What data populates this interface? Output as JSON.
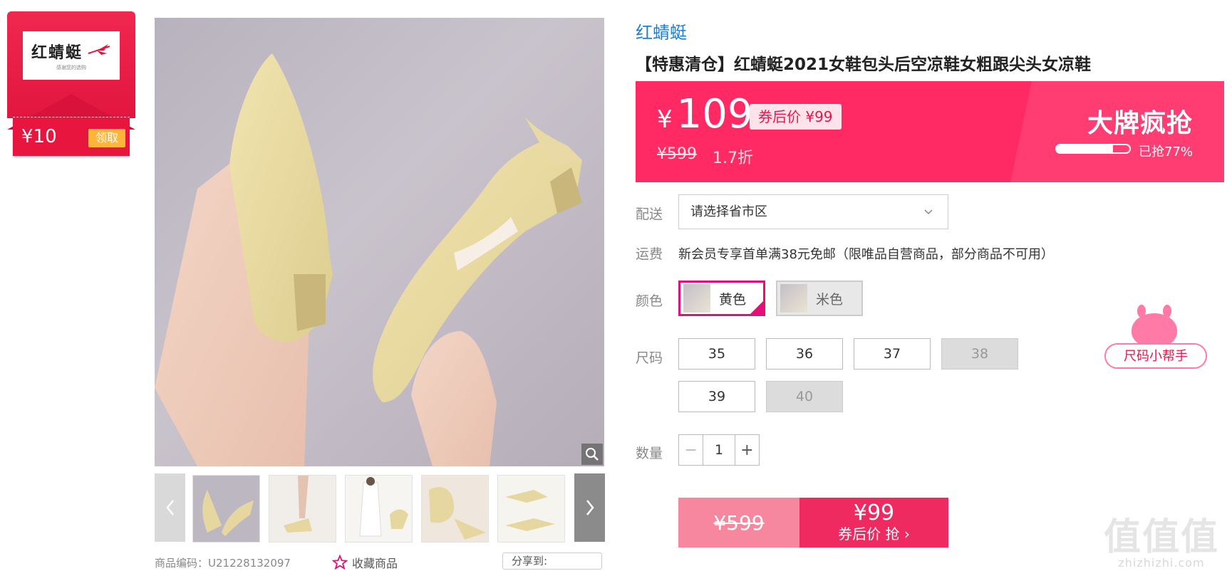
{
  "coupon": {
    "brand": "红蜻蜓",
    "brand_sub": "感谢您的选购",
    "amount": "¥10",
    "claim_label": "领取"
  },
  "gallery": {
    "thumbnail_count": 6
  },
  "meta": {
    "product_code_label": "商品编码：",
    "product_code": "U21228132097",
    "favorite_label": "收藏商品",
    "share_label": "分享到:"
  },
  "product": {
    "brand_link": "红蜻蜓",
    "title": "【特惠清仓】红蜻蜓2021女鞋包头后空凉鞋女粗跟尖头女凉鞋"
  },
  "price": {
    "currency": "¥",
    "current": "109",
    "after_coupon": "券后价 ¥99",
    "original": "¥599",
    "discount": "1.7折",
    "campaign": "大牌疯抢",
    "sold_percent": 77,
    "sold_label": "已抢77%"
  },
  "delivery": {
    "label": "配送",
    "placeholder": "请选择省市区"
  },
  "shipping": {
    "label": "运费",
    "text": "新会员专享首单满38元免邮（限唯品自营商品，部分商品不可用）"
  },
  "color": {
    "label": "颜色",
    "options": [
      {
        "name": "黄色",
        "selected": true
      },
      {
        "name": "米色",
        "selected": false
      }
    ]
  },
  "size": {
    "label": "尺码",
    "options": [
      {
        "value": "35",
        "available": true
      },
      {
        "value": "36",
        "available": true
      },
      {
        "value": "37",
        "available": true
      },
      {
        "value": "38",
        "available": false
      },
      {
        "value": "39",
        "available": true
      },
      {
        "value": "40",
        "available": false
      }
    ],
    "helper_label": "尺码小帮手"
  },
  "quantity": {
    "label": "数量",
    "value": "1"
  },
  "buy": {
    "original_price": "¥599",
    "coupon_price": "¥99",
    "action": "券后价 抢 ›"
  },
  "watermark": {
    "main": "值值值",
    "sub": "zhizhizhi.com"
  },
  "colors": {
    "accent": "#ff2a64",
    "selected_border": "#e4107a",
    "link": "#1c7ed6"
  }
}
